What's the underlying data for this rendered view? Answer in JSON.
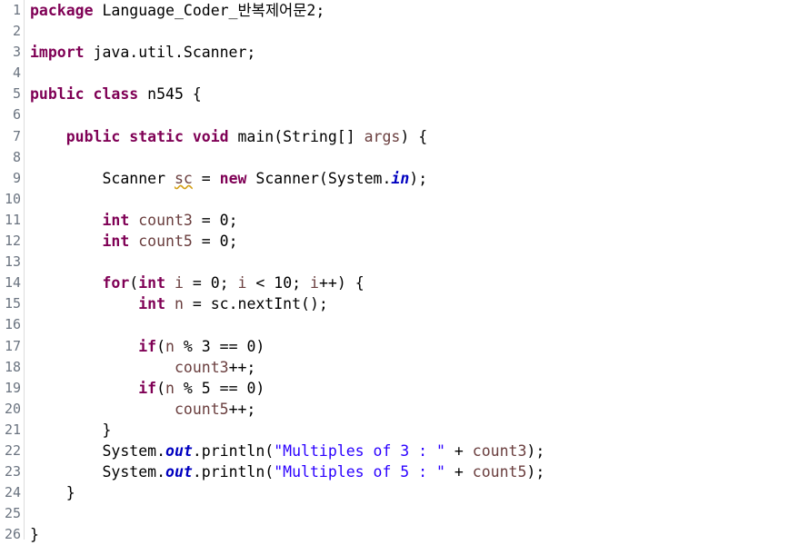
{
  "editor": {
    "language": "java",
    "font_size_px": 16.5,
    "line_height_px": 23.1,
    "total_lines": 26,
    "gutter": {
      "first_line": 1,
      "last_line": 26,
      "fold_marker_lines": [
        7
      ],
      "fold_marker_icon": "collapse-minus-icon"
    },
    "colors": {
      "background": "#ffffff",
      "gutter_text": "#6b7480",
      "gutter_border": "#dcdcdc",
      "keyword": "#7f0055",
      "string": "#2a00ff",
      "static_field": "#0000c0",
      "local_variable": "#6a3e3e",
      "plain_text": "#000000",
      "warning_squiggle": "#d4a017"
    }
  },
  "lines": [
    {
      "n": "1",
      "tokens": [
        {
          "t": "package ",
          "c": "kw"
        },
        {
          "t": "Language_Coder_반복제어문2;",
          "c": "plain"
        }
      ]
    },
    {
      "n": "2",
      "tokens": []
    },
    {
      "n": "3",
      "tokens": [
        {
          "t": "import ",
          "c": "kw"
        },
        {
          "t": "java.util.Scanner;",
          "c": "plain"
        }
      ]
    },
    {
      "n": "4",
      "tokens": []
    },
    {
      "n": "5",
      "tokens": [
        {
          "t": "public class ",
          "c": "kw"
        },
        {
          "t": "n545 {",
          "c": "plain"
        }
      ]
    },
    {
      "n": "6",
      "tokens": []
    },
    {
      "n": "7",
      "tokens": [
        {
          "t": "    ",
          "c": "plain"
        },
        {
          "t": "public static void ",
          "c": "kw"
        },
        {
          "t": "main(String[] ",
          "c": "plain"
        },
        {
          "t": "args",
          "c": "field"
        },
        {
          "t": ") {",
          "c": "plain"
        }
      ]
    },
    {
      "n": "8",
      "tokens": []
    },
    {
      "n": "9",
      "tokens": [
        {
          "t": "        Scanner ",
          "c": "plain"
        },
        {
          "t": "sc",
          "c": "warn"
        },
        {
          "t": " = ",
          "c": "plain"
        },
        {
          "t": "new ",
          "c": "kw"
        },
        {
          "t": "Scanner(System.",
          "c": "plain"
        },
        {
          "t": "in",
          "c": "statfld"
        },
        {
          "t": ");",
          "c": "plain"
        }
      ]
    },
    {
      "n": "10",
      "tokens": []
    },
    {
      "n": "11",
      "tokens": [
        {
          "t": "        ",
          "c": "plain"
        },
        {
          "t": "int ",
          "c": "kw"
        },
        {
          "t": "count3",
          "c": "field"
        },
        {
          "t": " = 0;",
          "c": "plain"
        }
      ]
    },
    {
      "n": "12",
      "tokens": [
        {
          "t": "        ",
          "c": "plain"
        },
        {
          "t": "int ",
          "c": "kw"
        },
        {
          "t": "count5",
          "c": "field"
        },
        {
          "t": " = 0;",
          "c": "plain"
        }
      ]
    },
    {
      "n": "13",
      "tokens": []
    },
    {
      "n": "14",
      "tokens": [
        {
          "t": "        ",
          "c": "plain"
        },
        {
          "t": "for",
          "c": "kw"
        },
        {
          "t": "(",
          "c": "plain"
        },
        {
          "t": "int ",
          "c": "kw"
        },
        {
          "t": "i",
          "c": "field"
        },
        {
          "t": " = 0; ",
          "c": "plain"
        },
        {
          "t": "i",
          "c": "field"
        },
        {
          "t": " < 10; ",
          "c": "plain"
        },
        {
          "t": "i",
          "c": "field"
        },
        {
          "t": "++) {",
          "c": "plain"
        }
      ]
    },
    {
      "n": "15",
      "tokens": [
        {
          "t": "            ",
          "c": "plain"
        },
        {
          "t": "int ",
          "c": "kw"
        },
        {
          "t": "n",
          "c": "field"
        },
        {
          "t": " = sc.nextInt();",
          "c": "plain"
        }
      ]
    },
    {
      "n": "16",
      "tokens": []
    },
    {
      "n": "17",
      "tokens": [
        {
          "t": "            ",
          "c": "plain"
        },
        {
          "t": "if",
          "c": "kw"
        },
        {
          "t": "(",
          "c": "plain"
        },
        {
          "t": "n",
          "c": "field"
        },
        {
          "t": " % 3 == 0)",
          "c": "plain"
        }
      ]
    },
    {
      "n": "18",
      "tokens": [
        {
          "t": "                ",
          "c": "plain"
        },
        {
          "t": "count3",
          "c": "field"
        },
        {
          "t": "++;",
          "c": "plain"
        }
      ]
    },
    {
      "n": "19",
      "tokens": [
        {
          "t": "            ",
          "c": "plain"
        },
        {
          "t": "if",
          "c": "kw"
        },
        {
          "t": "(",
          "c": "plain"
        },
        {
          "t": "n",
          "c": "field"
        },
        {
          "t": " % 5 == 0)",
          "c": "plain"
        }
      ]
    },
    {
      "n": "20",
      "tokens": [
        {
          "t": "                ",
          "c": "plain"
        },
        {
          "t": "count5",
          "c": "field"
        },
        {
          "t": "++;",
          "c": "plain"
        }
      ]
    },
    {
      "n": "21",
      "tokens": [
        {
          "t": "        }",
          "c": "plain"
        }
      ]
    },
    {
      "n": "22",
      "tokens": [
        {
          "t": "        System.",
          "c": "plain"
        },
        {
          "t": "out",
          "c": "statfld"
        },
        {
          "t": ".println(",
          "c": "plain"
        },
        {
          "t": "\"Multiples of 3 : \"",
          "c": "str"
        },
        {
          "t": " + ",
          "c": "plain"
        },
        {
          "t": "count3",
          "c": "field"
        },
        {
          "t": ");",
          "c": "plain"
        }
      ]
    },
    {
      "n": "23",
      "tokens": [
        {
          "t": "        System.",
          "c": "plain"
        },
        {
          "t": "out",
          "c": "statfld"
        },
        {
          "t": ".println(",
          "c": "plain"
        },
        {
          "t": "\"Multiples of 5 : \"",
          "c": "str"
        },
        {
          "t": " + ",
          "c": "plain"
        },
        {
          "t": "count5",
          "c": "field"
        },
        {
          "t": ");",
          "c": "plain"
        }
      ]
    },
    {
      "n": "24",
      "tokens": [
        {
          "t": "    }",
          "c": "plain"
        }
      ]
    },
    {
      "n": "25",
      "tokens": []
    },
    {
      "n": "26",
      "tokens": [
        {
          "t": "}",
          "c": "plain"
        }
      ]
    }
  ],
  "source_text": "package Language_Coder_반복제어문2;\n\nimport java.util.Scanner;\n\npublic class n545 {\n\n    public static void main(String[] args) {\n\n        Scanner sc = new Scanner(System.in);\n\n        int count3 = 0;\n        int count5 = 0;\n\n        for(int i = 0; i < 10; i++) {\n            int n = sc.nextInt();\n\n            if(n % 3 == 0)\n                count3++;\n            if(n % 5 == 0)\n                count5++;\n        }\n        System.out.println(\"Multiples of 3 : \" + count3);\n        System.out.println(\"Multiples of 5 : \" + count5);\n    }\n\n}"
}
